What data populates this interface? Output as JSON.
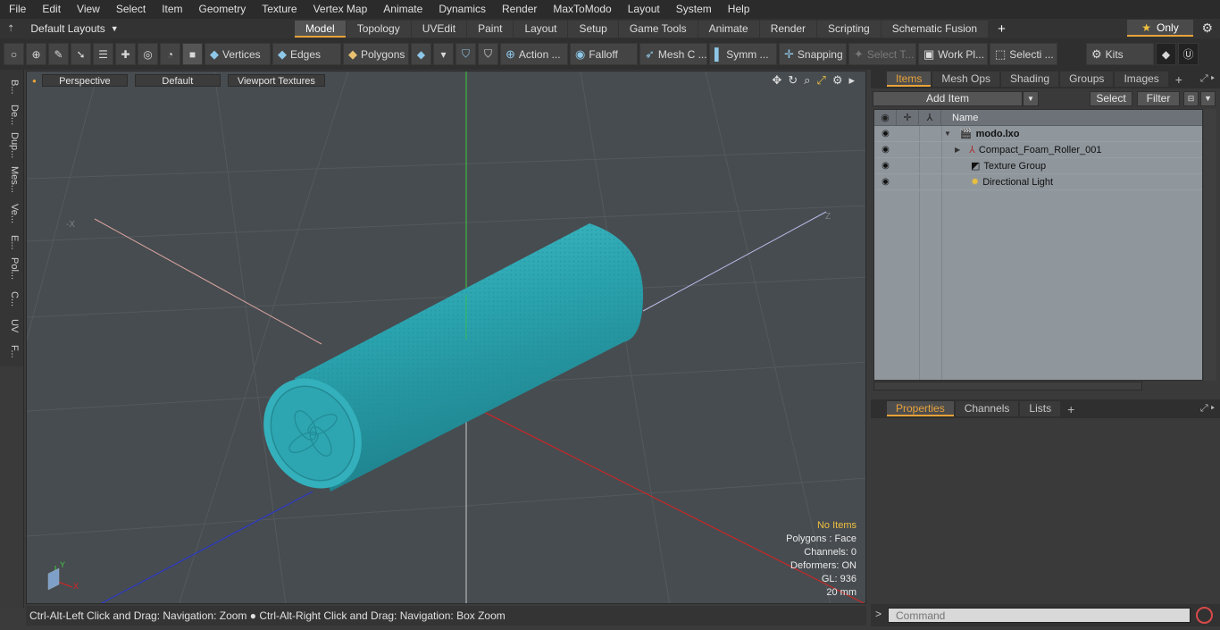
{
  "menu": [
    "File",
    "Edit",
    "View",
    "Select",
    "Item",
    "Geometry",
    "Texture",
    "Vertex Map",
    "Animate",
    "Dynamics",
    "Render",
    "MaxToModo",
    "Layout",
    "System",
    "Help"
  ],
  "layout_selector": "Default Layouts",
  "layout_tabs": [
    "Model",
    "Topology",
    "UVEdit",
    "Paint",
    "Layout",
    "Setup",
    "Game Tools",
    "Animate",
    "Render",
    "Scripting",
    "Schematic Fusion"
  ],
  "active_layout_tab": "Model",
  "only_label": "Only",
  "toolbar": {
    "vertices": "Vertices",
    "edges": "Edges",
    "polygons": "Polygons",
    "action": "Action ...",
    "falloff": "Falloff",
    "mesh_c": "Mesh C ...",
    "symm": "Symm ...",
    "snapping": "Snapping",
    "select_t": "Select T...",
    "work_pl": "Work Pl...",
    "selecti": "Selecti ...",
    "kits": "Kits"
  },
  "left_strip": [
    "B...",
    "De...",
    "Dup...",
    "Mes...",
    "Ve...",
    "E...",
    "Pol...",
    "C...",
    "UV",
    "F..."
  ],
  "viewport": {
    "view_mode": "Perspective",
    "shading": "Default",
    "textures": "Viewport Textures",
    "axis_x": "X",
    "axis_y": "Y",
    "axis_neg_x": "-X",
    "axis_z": "Z"
  },
  "stats": {
    "items": "No Items",
    "polygons": "Polygons : Face",
    "channels": "Channels: 0",
    "deformers": "Deformers: ON",
    "gl": "GL: 936",
    "scale": "20 mm"
  },
  "status_bar": "Ctrl-Alt-Left Click and Drag: Navigation: Zoom ● Ctrl-Alt-Right Click and Drag: Navigation: Box Zoom",
  "items_panel": {
    "tabs": [
      "Items",
      "Mesh Ops",
      "Shading",
      "Groups",
      "Images"
    ],
    "add_item": "Add Item",
    "select": "Select",
    "filter": "Filter",
    "name_header": "Name",
    "rows": [
      {
        "name": "modo.lxo"
      },
      {
        "name": "Compact_Foam_Roller_001"
      },
      {
        "name": "Texture Group"
      },
      {
        "name": "Directional Light"
      }
    ]
  },
  "properties_panel": {
    "tabs": [
      "Properties",
      "Channels",
      "Lists"
    ]
  },
  "command_placeholder": "Command",
  "colors": {
    "accent": "#e8a23a",
    "roller": "#2aa5b0",
    "viewport_bg": "#474c50"
  }
}
